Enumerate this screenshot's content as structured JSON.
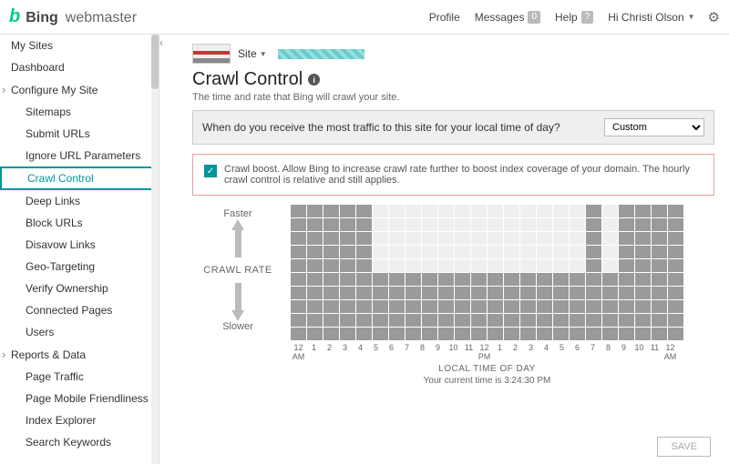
{
  "brand": {
    "b": "b",
    "bing": "Bing",
    "wm": "webmaster"
  },
  "top": {
    "profile": "Profile",
    "messages": "Messages",
    "messages_count": "0",
    "help": "Help",
    "help_badge": "?",
    "greeting": "Hi Christi Olson"
  },
  "sidebar": {
    "items": [
      {
        "label": "My Sites",
        "level": 1,
        "exp": false
      },
      {
        "label": "Dashboard",
        "level": 1,
        "exp": false
      },
      {
        "label": "Configure My Site",
        "level": 1,
        "exp": true
      },
      {
        "label": "Sitemaps",
        "level": 2
      },
      {
        "label": "Submit URLs",
        "level": 2
      },
      {
        "label": "Ignore URL Parameters",
        "level": 2
      },
      {
        "label": "Crawl Control",
        "level": 2,
        "active": true
      },
      {
        "label": "Deep Links",
        "level": 2
      },
      {
        "label": "Block URLs",
        "level": 2
      },
      {
        "label": "Disavow Links",
        "level": 2
      },
      {
        "label": "Geo-Targeting",
        "level": 2
      },
      {
        "label": "Verify Ownership",
        "level": 2
      },
      {
        "label": "Connected Pages",
        "level": 2
      },
      {
        "label": "Users",
        "level": 2
      },
      {
        "label": "Reports & Data",
        "level": 1,
        "exp": true
      },
      {
        "label": "Page Traffic",
        "level": 2
      },
      {
        "label": "Page Mobile Friendliness",
        "level": 2
      },
      {
        "label": "Index Explorer",
        "level": 2
      },
      {
        "label": "Search Keywords",
        "level": 2
      }
    ]
  },
  "site_dd": "Site",
  "page": {
    "title": "Crawl Control",
    "subtitle": "The time and rate that Bing will crawl your site.",
    "traffic_q": "When do you receive the most traffic to this site for your local time of day?",
    "traffic_option": "Custom",
    "boost_text": "Crawl boost. Allow Bing to increase crawl rate further to boost index coverage of your domain. The hourly crawl control is relative and still applies.",
    "faster": "Faster",
    "slower": "Slower",
    "rate_label": "CRAWL RATE",
    "x_ticks": [
      "12 AM",
      "1",
      "2",
      "3",
      "4",
      "5",
      "6",
      "7",
      "8",
      "9",
      "10",
      "11",
      "12 PM",
      "1",
      "2",
      "3",
      "4",
      "5",
      "6",
      "7",
      "8",
      "9",
      "10",
      "11",
      "12 AM"
    ],
    "x_axis": "LOCAL TIME OF DAY",
    "time_now": "Your current time is 3:24:30 PM",
    "save": "SAVE"
  },
  "chart_data": {
    "type": "heatmap",
    "rows": 10,
    "cols": 24,
    "xlabel": "LOCAL TIME OF DAY",
    "ylabel": "CRAWL RATE",
    "y_top": "Faster",
    "y_bottom": "Slower",
    "categories_x": [
      "12 AM",
      "1",
      "2",
      "3",
      "4",
      "5",
      "6",
      "7",
      "8",
      "9",
      "10",
      "11",
      "12 PM",
      "1",
      "2",
      "3",
      "4",
      "5",
      "6",
      "7",
      "8",
      "9",
      "10",
      "11"
    ],
    "column_levels": [
      10,
      10,
      10,
      10,
      10,
      5,
      5,
      5,
      5,
      5,
      5,
      5,
      5,
      5,
      5,
      5,
      5,
      5,
      10,
      5,
      10,
      10,
      10,
      10
    ],
    "notes": "column_levels[i] = number of filled cells from bottom for hour i; 10=full (faster allowed), 5=half (slower period)."
  }
}
